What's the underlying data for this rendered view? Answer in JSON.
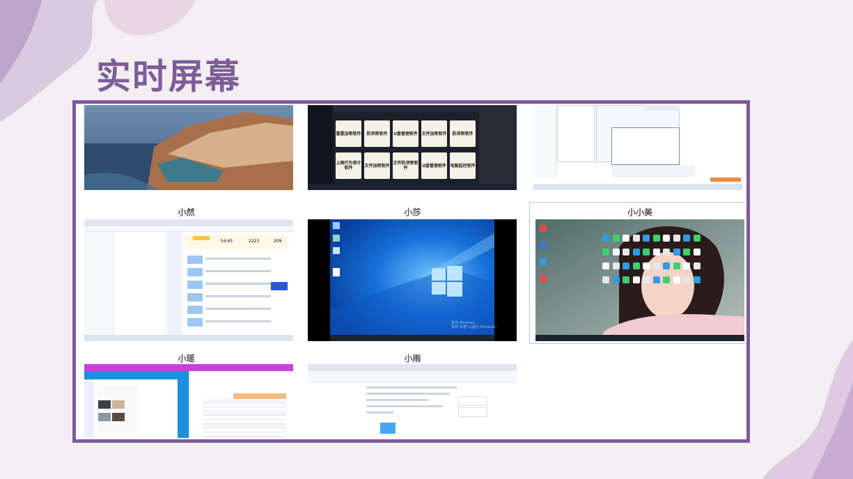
{
  "page": {
    "title": "实时屏幕"
  },
  "screens": [
    {
      "label": "",
      "desktop": "coastal-cliff-photo"
    },
    {
      "label": "",
      "desktop": "software-catalog-dark"
    },
    {
      "label": "",
      "desktop": "file-manager-windows"
    },
    {
      "label": "小然",
      "desktop": "browser-dashboard"
    },
    {
      "label": "小莎",
      "desktop": "windows-10-default",
      "watermark": [
        "激活 Windows",
        "转到\"设置\"以激活 Windows。"
      ]
    },
    {
      "label": "小小美",
      "desktop": "portrait-wallpaper",
      "selected": true
    },
    {
      "label": "小瑶",
      "desktop": "spreadsheet-app"
    },
    {
      "label": "小雨",
      "desktop": "document-editor"
    }
  ],
  "software_cards": [
    "重要加密软件",
    "防泄密软件",
    "U盘管理软件",
    "文件加密软件",
    "防泄密软件",
    "上网行为审计软件",
    "文件加密软件",
    "文件防泄密软件",
    "U盘管理软件",
    "电脑监控软件",
    "文件防泄密软件"
  ],
  "dashboard_stats": [
    "54.65",
    "2223",
    "209"
  ],
  "colors": {
    "title": "#7d5c97",
    "frame_border": "#7f5a9b",
    "page_bg": "#f2eef2",
    "selected_outline": "#a8c8ee"
  }
}
